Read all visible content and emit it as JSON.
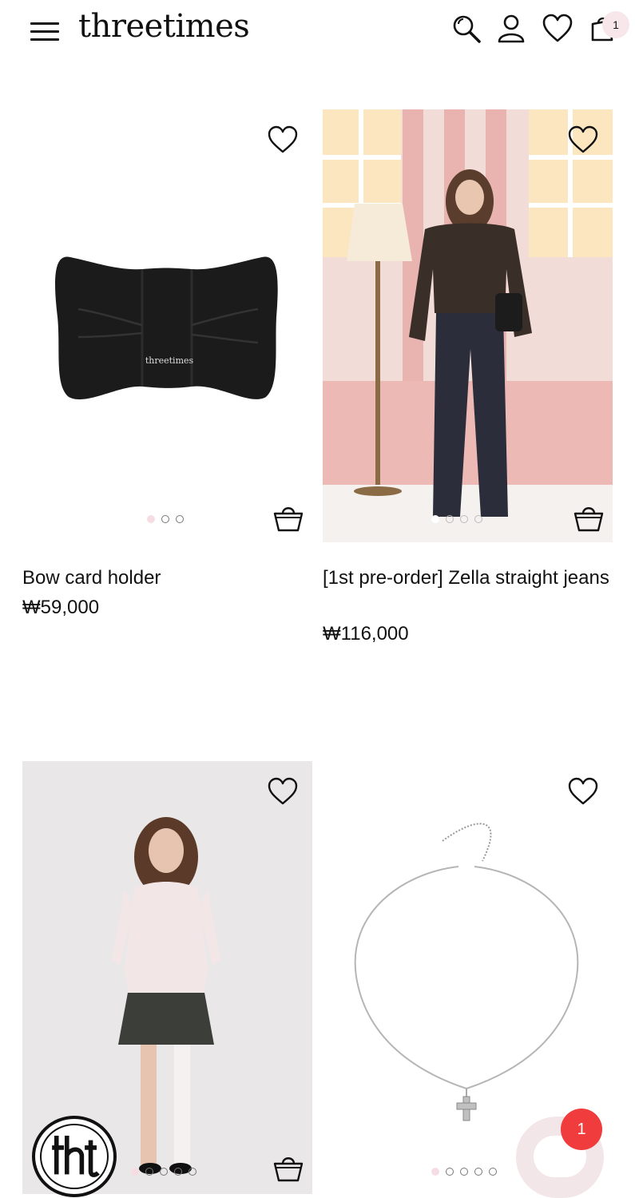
{
  "header": {
    "logo": "threetimes",
    "cart_count": "1"
  },
  "products": [
    {
      "name": "Bow card holder",
      "price": "₩59,000",
      "imprint": "threetimes",
      "slides": 3,
      "active": 0
    },
    {
      "name": "[1st pre-order] Zella straight jeans",
      "price": "₩116,000",
      "slides": 4,
      "active": 0
    },
    {
      "name": "",
      "price": "",
      "slides": 5,
      "active": 0
    },
    {
      "name": "",
      "price": "",
      "slides": 5,
      "active": 0
    }
  ],
  "chat": {
    "badge": "1"
  },
  "icons": [
    "menu-icon",
    "search-icon",
    "user-icon",
    "heart-icon",
    "cart-icon",
    "bag-icon",
    "chat-icon"
  ],
  "colors": {
    "accent_pink": "#f6dde3",
    "badge_red": "#f03c3c"
  }
}
